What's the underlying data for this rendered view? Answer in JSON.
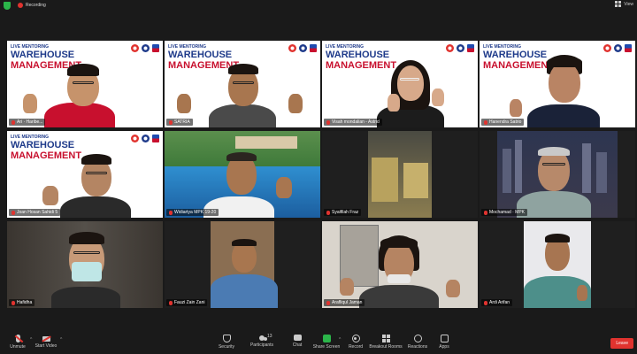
{
  "topbar": {
    "recording_label": "Recording",
    "view_label": "View"
  },
  "tiles": [
    {
      "name": "Ari · Haribe..."
    },
    {
      "name": "SATRIA"
    },
    {
      "name": "Visah mondalian - Astrid"
    },
    {
      "name": "Hanendra Satrio"
    },
    {
      "name": "Joan Hosan Sahidi 5"
    },
    {
      "name": "Widiartya MPK 19-20"
    },
    {
      "name": "Syaifilah Fraz"
    },
    {
      "name": "Mochamad · MPK"
    },
    {
      "name": "Hafidha"
    },
    {
      "name": "Fauzi Zain Zani"
    },
    {
      "name": "Arafliqul Jaman"
    },
    {
      "name": "Ardi Arifan"
    }
  ],
  "banner": {
    "small": "LIVE MENTORING",
    "line1": "WAREHOUSE",
    "line2": "MANAGEMENT"
  },
  "toolbar": {
    "unmute": "Unmute",
    "start_video": "Start Video",
    "security": "Security",
    "participants": "Participants",
    "participants_count": "13",
    "chat": "Chat",
    "share_screen": "Share Screen",
    "record": "Record",
    "breakout": "Breakout Rooms",
    "reactions": "Reactions",
    "apps": "Apps",
    "leave": "Leave"
  },
  "colors": {
    "active_speaker": "#c7f04a",
    "brand_red": "#c8102e",
    "brand_blue": "#1e3a8a",
    "share_green": "#2bb54a"
  }
}
